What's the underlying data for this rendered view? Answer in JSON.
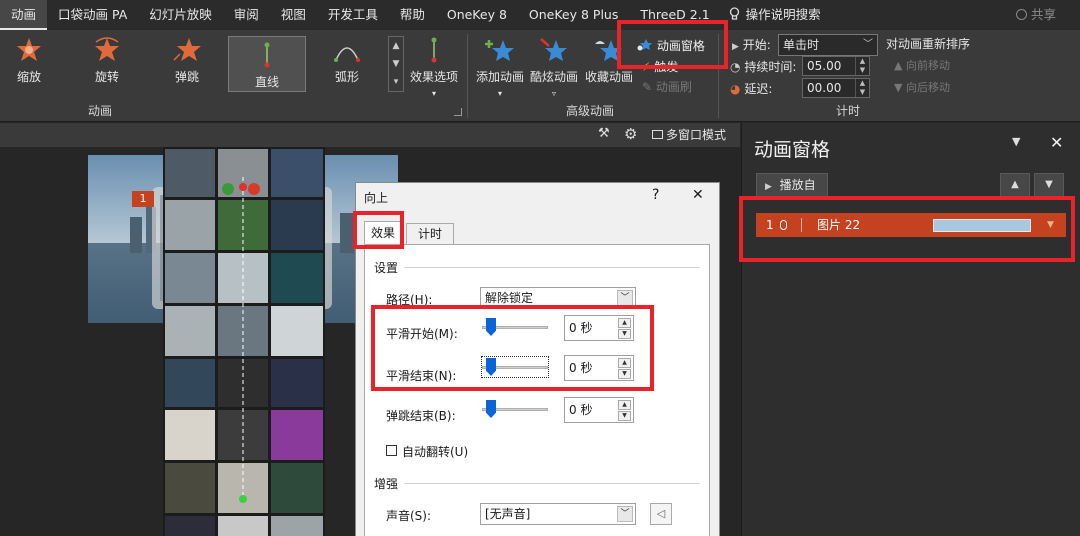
{
  "tabs": [
    "动画",
    "口袋动画 PA",
    "幻灯片放映",
    "审阅",
    "视图",
    "开发工具",
    "帮助",
    "OneKey 8",
    "OneKey 8 Plus",
    "ThreeD 2.1"
  ],
  "search_label": "操作说明搜索",
  "share_label": "共享",
  "ribbon": {
    "effects": [
      "缩放",
      "旋转",
      "弹跳",
      "直线",
      "弧形"
    ],
    "effect_options": "效果选项",
    "group_animation": "动画",
    "add_animation": "添加动画",
    "anim_brush": "酷炫动画",
    "favorites": "收藏动画",
    "anim_pane_btn": "动画窗格",
    "trigger": "触发",
    "anim_painter": "动画刷",
    "group_advanced": "高级动画",
    "start_label": "开始:",
    "start_value": "单击时",
    "duration_label": "持续时间:",
    "duration_value": "05.00",
    "delay_label": "延迟:",
    "delay_value": "00.00",
    "reorder_title": "对动画重新排序",
    "move_earlier": "向前移动",
    "move_later": "向后移动",
    "group_timing": "计时"
  },
  "subbar": {
    "multiwindow": "多窗口模式"
  },
  "slide": {
    "badge": "1"
  },
  "pane": {
    "title": "动画窗格",
    "play_from": "播放自",
    "item_index": "1",
    "item_name": "图片 22"
  },
  "dialog": {
    "title": "向上",
    "help": "?",
    "close": "✕",
    "tab_effect": "效果",
    "tab_timing": "计时",
    "section_settings": "设置",
    "path_label": "路径(H):",
    "path_value": "解除锁定",
    "smooth_start_label": "平滑开始(M):",
    "smooth_start_value": "0 秒",
    "smooth_end_label": "平滑结束(N):",
    "smooth_end_value": "0 秒",
    "bounce_end_label": "弹跳结束(B):",
    "bounce_end_value": "0 秒",
    "auto_reverse_label": "自动翻转(U)",
    "section_enhance": "增强",
    "sound_label": "声音(S):",
    "sound_value": "[无声音]"
  },
  "colors": {
    "highlight": "#e8242a",
    "accent_orange": "#e06a3a",
    "pane_item": "#c4421f",
    "slider_blue": "#0a64d8"
  },
  "icons": [
    "star-burst-icon",
    "star-spin-icon",
    "star-bounce-icon",
    "line-path-icon",
    "arc-path-icon",
    "add-star-icon",
    "brush-star-icon",
    "favorite-star-icon",
    "pane-icon",
    "lightbulb-icon",
    "user-icon",
    "mouse-icon",
    "play-icon",
    "close-icon"
  ]
}
